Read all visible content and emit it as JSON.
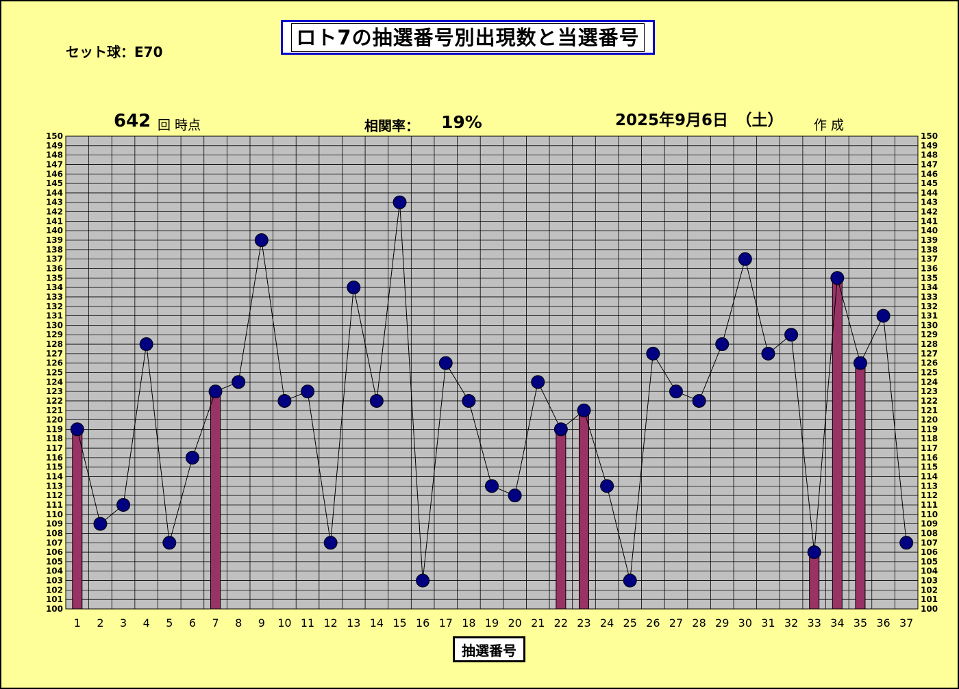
{
  "title": "ロト7の抽選番号別出現数と当選番号",
  "ball_set": "セット球：E70",
  "draw_count": "642",
  "draw_count_suffix": "回 時点",
  "correlation_label": "相関率：",
  "correlation_value": "19%",
  "date": "2025年9月6日　（土）",
  "made_label": "作 成",
  "colors": {
    "background": "#ffff99",
    "plot": "#c0c0c0",
    "bar": "#993366",
    "marker": "#000080",
    "title_border": "#0000cc"
  },
  "chart_data": {
    "type": "bar+line",
    "xlabel": "抽選番号",
    "ylim": [
      100,
      150
    ],
    "y_tick_step": 1,
    "grid": true,
    "categories": [
      1,
      2,
      3,
      4,
      5,
      6,
      7,
      8,
      9,
      10,
      11,
      12,
      13,
      14,
      15,
      16,
      17,
      18,
      19,
      20,
      21,
      22,
      23,
      24,
      25,
      26,
      27,
      28,
      29,
      30,
      31,
      32,
      33,
      34,
      35,
      36,
      37
    ],
    "series": [
      {
        "kind": "line",
        "values": [
          119,
          109,
          111,
          128,
          107,
          116,
          123,
          124,
          139,
          122,
          123,
          107,
          134,
          122,
          143,
          103,
          126,
          122,
          113,
          112,
          124,
          119,
          121,
          113,
          103,
          127,
          123,
          122,
          128,
          137,
          127,
          129,
          106,
          135,
          126,
          131,
          107
        ]
      },
      {
        "kind": "bar",
        "values": [
          119,
          null,
          null,
          null,
          null,
          null,
          123,
          null,
          null,
          null,
          null,
          null,
          null,
          null,
          null,
          null,
          null,
          null,
          null,
          null,
          null,
          119,
          121,
          null,
          null,
          null,
          null,
          null,
          null,
          null,
          null,
          null,
          106,
          135,
          126,
          null,
          null
        ]
      }
    ]
  }
}
